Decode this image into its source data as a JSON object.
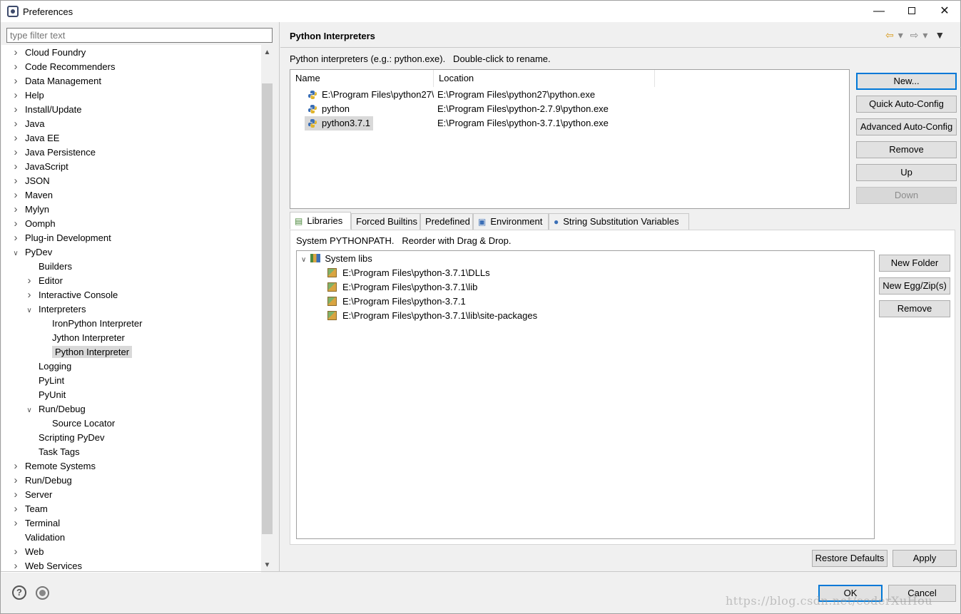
{
  "window": {
    "title": "Preferences"
  },
  "filter": {
    "placeholder": "type filter text"
  },
  "tree": [
    {
      "label": "Cloud Foundry",
      "level": 0,
      "twisty": "closed"
    },
    {
      "label": "Code Recommenders",
      "level": 0,
      "twisty": "closed"
    },
    {
      "label": "Data Management",
      "level": 0,
      "twisty": "closed"
    },
    {
      "label": "Help",
      "level": 0,
      "twisty": "closed"
    },
    {
      "label": "Install/Update",
      "level": 0,
      "twisty": "closed"
    },
    {
      "label": "Java",
      "level": 0,
      "twisty": "closed"
    },
    {
      "label": "Java EE",
      "level": 0,
      "twisty": "closed"
    },
    {
      "label": "Java Persistence",
      "level": 0,
      "twisty": "closed"
    },
    {
      "label": "JavaScript",
      "level": 0,
      "twisty": "closed"
    },
    {
      "label": "JSON",
      "level": 0,
      "twisty": "closed"
    },
    {
      "label": "Maven",
      "level": 0,
      "twisty": "closed"
    },
    {
      "label": "Mylyn",
      "level": 0,
      "twisty": "closed"
    },
    {
      "label": "Oomph",
      "level": 0,
      "twisty": "closed"
    },
    {
      "label": "Plug-in Development",
      "level": 0,
      "twisty": "closed"
    },
    {
      "label": "PyDev",
      "level": 0,
      "twisty": "open"
    },
    {
      "label": "Builders",
      "level": 1,
      "twisty": "none"
    },
    {
      "label": "Editor",
      "level": 1,
      "twisty": "closed"
    },
    {
      "label": "Interactive Console",
      "level": 1,
      "twisty": "closed"
    },
    {
      "label": "Interpreters",
      "level": 1,
      "twisty": "open"
    },
    {
      "label": "IronPython Interpreter",
      "level": 2,
      "twisty": "none"
    },
    {
      "label": "Jython Interpreter",
      "level": 2,
      "twisty": "none"
    },
    {
      "label": "Python Interpreter",
      "level": 2,
      "twisty": "none",
      "selected": true
    },
    {
      "label": "Logging",
      "level": 1,
      "twisty": "none"
    },
    {
      "label": "PyLint",
      "level": 1,
      "twisty": "none"
    },
    {
      "label": "PyUnit",
      "level": 1,
      "twisty": "none"
    },
    {
      "label": "Run/Debug",
      "level": 1,
      "twisty": "open"
    },
    {
      "label": "Source Locator",
      "level": 2,
      "twisty": "none"
    },
    {
      "label": "Scripting PyDev",
      "level": 1,
      "twisty": "none"
    },
    {
      "label": "Task Tags",
      "level": 1,
      "twisty": "none"
    },
    {
      "label": "Remote Systems",
      "level": 0,
      "twisty": "closed"
    },
    {
      "label": "Run/Debug",
      "level": 0,
      "twisty": "closed"
    },
    {
      "label": "Server",
      "level": 0,
      "twisty": "closed"
    },
    {
      "label": "Team",
      "level": 0,
      "twisty": "closed"
    },
    {
      "label": "Terminal",
      "level": 0,
      "twisty": "closed"
    },
    {
      "label": "Validation",
      "level": 0,
      "twisty": "none"
    },
    {
      "label": "Web",
      "level": 0,
      "twisty": "closed"
    },
    {
      "label": "Web Services",
      "level": 0,
      "twisty": "closed"
    }
  ],
  "page": {
    "title": "Python Interpreters",
    "description": "Python interpreters (e.g.: python.exe).   Double-click to rename."
  },
  "interpreters": {
    "columns": [
      "Name",
      "Location"
    ],
    "rows": [
      {
        "name": "E:\\Program Files\\python27\\",
        "location": "E:\\Program Files\\python27\\python.exe"
      },
      {
        "name": "python",
        "location": "E:\\Program Files\\python-2.7.9\\python.exe"
      },
      {
        "name": "python3.7.1",
        "location": "E:\\Program Files\\python-3.7.1\\python.exe",
        "selected": true
      }
    ]
  },
  "side_buttons": [
    {
      "name": "new-button",
      "label": "New...",
      "default": true
    },
    {
      "name": "quick-auto-config-button",
      "label": "Quick Auto-Config"
    },
    {
      "name": "advanced-auto-config-button",
      "label": "Advanced Auto-Config"
    },
    {
      "name": "remove-interpreter-button",
      "label": "Remove"
    },
    {
      "name": "up-button",
      "label": "Up"
    },
    {
      "name": "down-button",
      "label": "Down",
      "disabled": true
    }
  ],
  "tabs": [
    {
      "label": "Libraries",
      "icon": "libraries-icon",
      "active": true
    },
    {
      "label": "Forced Builtins"
    },
    {
      "label": "Predefined"
    },
    {
      "label": "Environment",
      "icon": "environment-icon"
    },
    {
      "label": "String Substitution Variables",
      "icon": "variables-icon"
    }
  ],
  "libraries": {
    "description": "System PYTHONPATH.   Reorder with Drag & Drop.",
    "root": "System libs",
    "items": [
      "E:\\Program Files\\python-3.7.1\\DLLs",
      "E:\\Program Files\\python-3.7.1\\lib",
      "E:\\Program Files\\python-3.7.1",
      "E:\\Program Files\\python-3.7.1\\lib\\site-packages"
    ],
    "buttons": [
      "New Folder",
      "New Egg/Zip(s)",
      "Remove"
    ]
  },
  "footer": {
    "restore_defaults": "Restore Defaults",
    "apply": "Apply",
    "ok": "OK",
    "cancel": "Cancel",
    "watermark": "https://blog.csdn.net/coderXuHou"
  },
  "colors": {
    "selection": "#d9d9d9",
    "default_button_border": "#0078d7",
    "background": "#f0f0f0"
  }
}
